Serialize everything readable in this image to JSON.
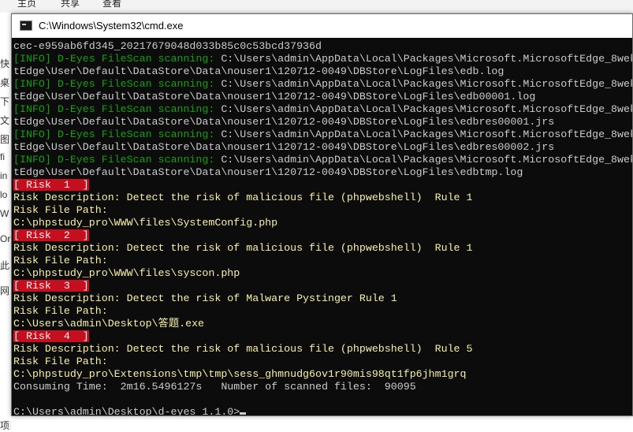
{
  "background": {
    "ribbon_tabs": [
      "主页",
      "共享",
      "查看"
    ],
    "left_items": [
      "快",
      "桌",
      "下",
      "文",
      "图",
      "fi",
      "in",
      "lo",
      "W",
      "Or",
      "此",
      "网"
    ],
    "bottom_text": "项目"
  },
  "window": {
    "title": "C:\\Windows\\System32\\cmd.exe",
    "icon": "cmd-icon"
  },
  "console": {
    "lines": [
      {
        "parts": [
          {
            "t": "cec-e959ab6fd345_20217679048d033b85c0c53bcd37936d",
            "c": "path"
          }
        ]
      },
      {
        "parts": [
          {
            "t": "[INFO] D-Eyes FileScan scanning: ",
            "c": "info"
          },
          {
            "t": "C:\\Users\\admin\\AppData\\Local\\Packages\\Microsoft.MicrosoftEdge_8wek",
            "c": "path"
          }
        ]
      },
      {
        "parts": [
          {
            "t": "tEdge\\User\\Default\\DataStore\\Data\\nouser1\\120712-0049\\DBStore\\LogFiles\\edb.log",
            "c": "path"
          }
        ]
      },
      {
        "parts": [
          {
            "t": "[INFO] D-Eyes FileScan scanning: ",
            "c": "info"
          },
          {
            "t": "C:\\Users\\admin\\AppData\\Local\\Packages\\Microsoft.MicrosoftEdge_8wek",
            "c": "path"
          }
        ]
      },
      {
        "parts": [
          {
            "t": "tEdge\\User\\Default\\DataStore\\Data\\nouser1\\120712-0049\\DBStore\\LogFiles\\edb00001.log",
            "c": "path"
          }
        ]
      },
      {
        "parts": [
          {
            "t": "[INFO] D-Eyes FileScan scanning: ",
            "c": "info"
          },
          {
            "t": "C:\\Users\\admin\\AppData\\Local\\Packages\\Microsoft.MicrosoftEdge_8wek",
            "c": "path"
          }
        ]
      },
      {
        "parts": [
          {
            "t": "tEdge\\User\\Default\\DataStore\\Data\\nouser1\\120712-0049\\DBStore\\LogFiles\\edbres00001.jrs",
            "c": "path"
          }
        ]
      },
      {
        "parts": [
          {
            "t": "[INFO] D-Eyes FileScan scanning: ",
            "c": "info"
          },
          {
            "t": "C:\\Users\\admin\\AppData\\Local\\Packages\\Microsoft.MicrosoftEdge_8wek",
            "c": "path"
          }
        ]
      },
      {
        "parts": [
          {
            "t": "tEdge\\User\\Default\\DataStore\\Data\\nouser1\\120712-0049\\DBStore\\LogFiles\\edbres00002.jrs",
            "c": "path"
          }
        ]
      },
      {
        "parts": [
          {
            "t": "[INFO] D-Eyes FileScan scanning: ",
            "c": "info"
          },
          {
            "t": "C:\\Users\\admin\\AppData\\Local\\Packages\\Microsoft.MicrosoftEdge_8wek",
            "c": "path"
          }
        ]
      },
      {
        "parts": [
          {
            "t": "tEdge\\User\\Default\\DataStore\\Data\\nouser1\\120712-0049\\DBStore\\LogFiles\\edbtmp.log",
            "c": "path"
          }
        ]
      },
      {
        "parts": [
          {
            "t": "[ Risk  1  ]",
            "c": "risk"
          }
        ]
      },
      {
        "parts": [
          {
            "t": "Risk Description: Detect the risk of malicious file (phpwebshell)  Rule 1",
            "c": "yellow"
          }
        ]
      },
      {
        "parts": [
          {
            "t": "Risk File Path:",
            "c": "yellow"
          }
        ]
      },
      {
        "parts": [
          {
            "t": "C:\\phpstudy_pro\\WWW\\files\\SystemConfig.php",
            "c": "yellow"
          }
        ]
      },
      {
        "parts": [
          {
            "t": "[ Risk  2  ]",
            "c": "risk"
          }
        ]
      },
      {
        "parts": [
          {
            "t": "Risk Description: Detect the risk of malicious file (phpwebshell)  Rule 1",
            "c": "yellow"
          }
        ]
      },
      {
        "parts": [
          {
            "t": "Risk File Path:",
            "c": "yellow"
          }
        ]
      },
      {
        "parts": [
          {
            "t": "C:\\phpstudy_pro\\WWW\\files\\syscon.php",
            "c": "yellow"
          }
        ]
      },
      {
        "parts": [
          {
            "t": "[ Risk  3  ]",
            "c": "risk"
          }
        ]
      },
      {
        "parts": [
          {
            "t": "Risk Description: Detect the risk of Malware Pystinger Rule 1",
            "c": "yellow"
          }
        ]
      },
      {
        "parts": [
          {
            "t": "Risk File Path:",
            "c": "yellow"
          }
        ]
      },
      {
        "parts": [
          {
            "t": "C:\\Users\\admin\\Desktop\\答题.exe",
            "c": "yellow"
          }
        ]
      },
      {
        "parts": [
          {
            "t": "[ Risk  4  ]",
            "c": "risk"
          }
        ]
      },
      {
        "parts": [
          {
            "t": "Risk Description: Detect the risk of malicious file (phpwebshell)  Rule 5",
            "c": "yellow"
          }
        ]
      },
      {
        "parts": [
          {
            "t": "Risk File Path:",
            "c": "yellow"
          }
        ]
      },
      {
        "parts": [
          {
            "t": "C:\\phpstudy_pro\\Extensions\\tmp\\tmp\\sess_ghmnudg6ov1r90mis98qt1fp6jhm1grq",
            "c": "yellow"
          }
        ]
      },
      {
        "parts": [
          {
            "t": "Consuming Time:  2m16.5496127s   Number of scanned files:  90095",
            "c": "path"
          }
        ]
      },
      {
        "parts": [
          {
            "t": "",
            "c": "path"
          }
        ]
      },
      {
        "parts": [
          {
            "t": "C:\\Users\\admin\\Desktop\\d-eyes_1.1.0>",
            "c": "path"
          }
        ],
        "cursor": true
      }
    ]
  },
  "colors": {
    "console_bg": "#0c0c0c",
    "info_green": "#13a10e",
    "risk_red": "#c50f1f",
    "risk_yellow": "#f9f1a5",
    "text_gray": "#cccccc"
  }
}
